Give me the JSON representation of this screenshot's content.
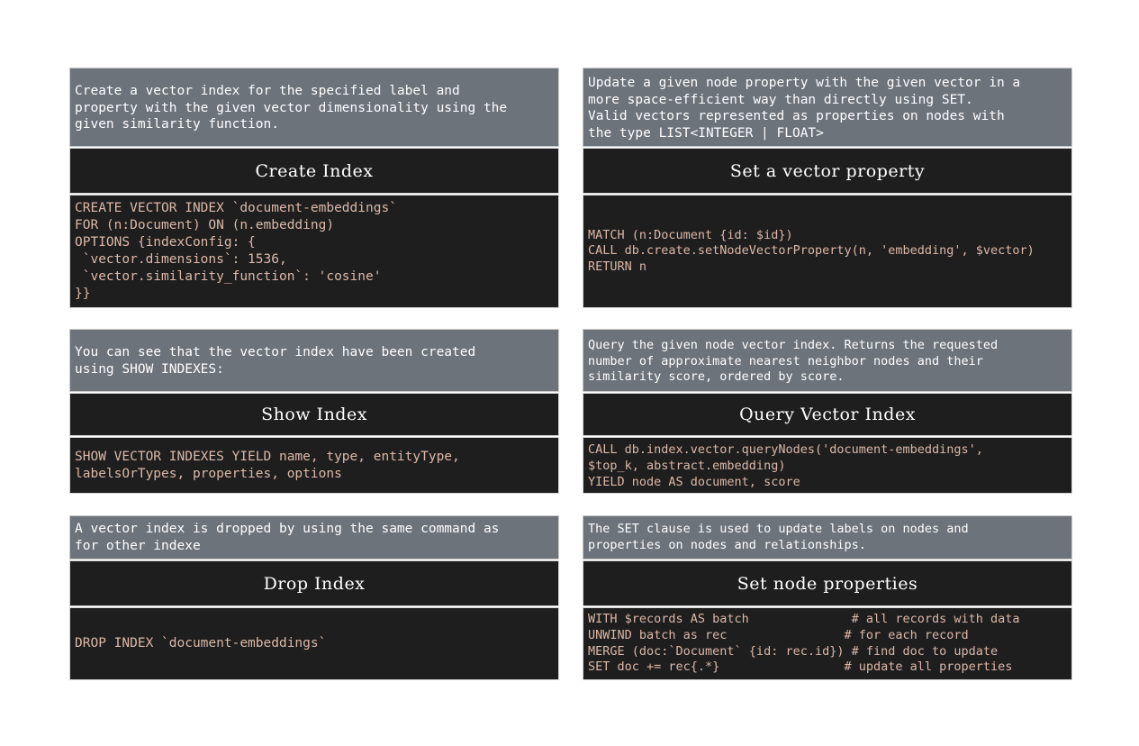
{
  "cards": [
    {
      "id": "create",
      "description": "Create a vector index for the specified label and\nproperty with the given vector dimensionality using the\ngiven similarity function.",
      "title": "Create Index",
      "code": [
        "CREATE VECTOR INDEX `document-embeddings`",
        "FOR (n:Document) ON (n.embedding)",
        "OPTIONS {indexConfig: {",
        " `vector.dimensions`: 1536,",
        " `vector.similarity_function`: 'cosine'",
        "}}"
      ]
    },
    {
      "id": "set-vector",
      "description": "Update a given node property with the given vector in a\nmore space-efficient way than directly using SET.\nValid vectors represented as properties on nodes with\nthe type LIST<INTEGER | FLOAT>",
      "title": "Set a vector property",
      "code": [
        "MATCH (n:Document {id: $id})",
        "CALL db.create.setNodeVectorProperty(n, 'embedding', $vector)",
        "RETURN n"
      ]
    },
    {
      "id": "show",
      "description": "You can see that the vector index have been created\nusing SHOW INDEXES:",
      "title": "Show Index",
      "code": [
        "SHOW VECTOR INDEXES YIELD name, type, entityType,",
        "labelsOrTypes, properties, options"
      ]
    },
    {
      "id": "query",
      "description": "Query the given node vector index. Returns the requested\nnumber of approximate nearest neighbor nodes and their\nsimilarity score, ordered by score.",
      "title": "Query Vector Index",
      "code": [
        "CALL db.index.vector.queryNodes('document-embeddings',",
        "$top_k, abstract.embedding)",
        "YIELD node AS document, score"
      ]
    },
    {
      "id": "drop",
      "description": "A vector index is dropped by using the same command as\nfor other indexe",
      "title": "Drop Index",
      "code": [
        "DROP INDEX `document-embeddings`"
      ]
    },
    {
      "id": "set-props",
      "description": "The SET clause is used to update labels on nodes and\nproperties on nodes and relationships.",
      "title": "Set node properties",
      "code": [
        "WITH $records AS batch              # all records with data",
        "UNWIND batch as rec                # for each record",
        "MERGE (doc:`Document` {id: rec.id}) # find doc to update",
        "SET doc += rec{.*}                 # update all properties"
      ]
    }
  ]
}
